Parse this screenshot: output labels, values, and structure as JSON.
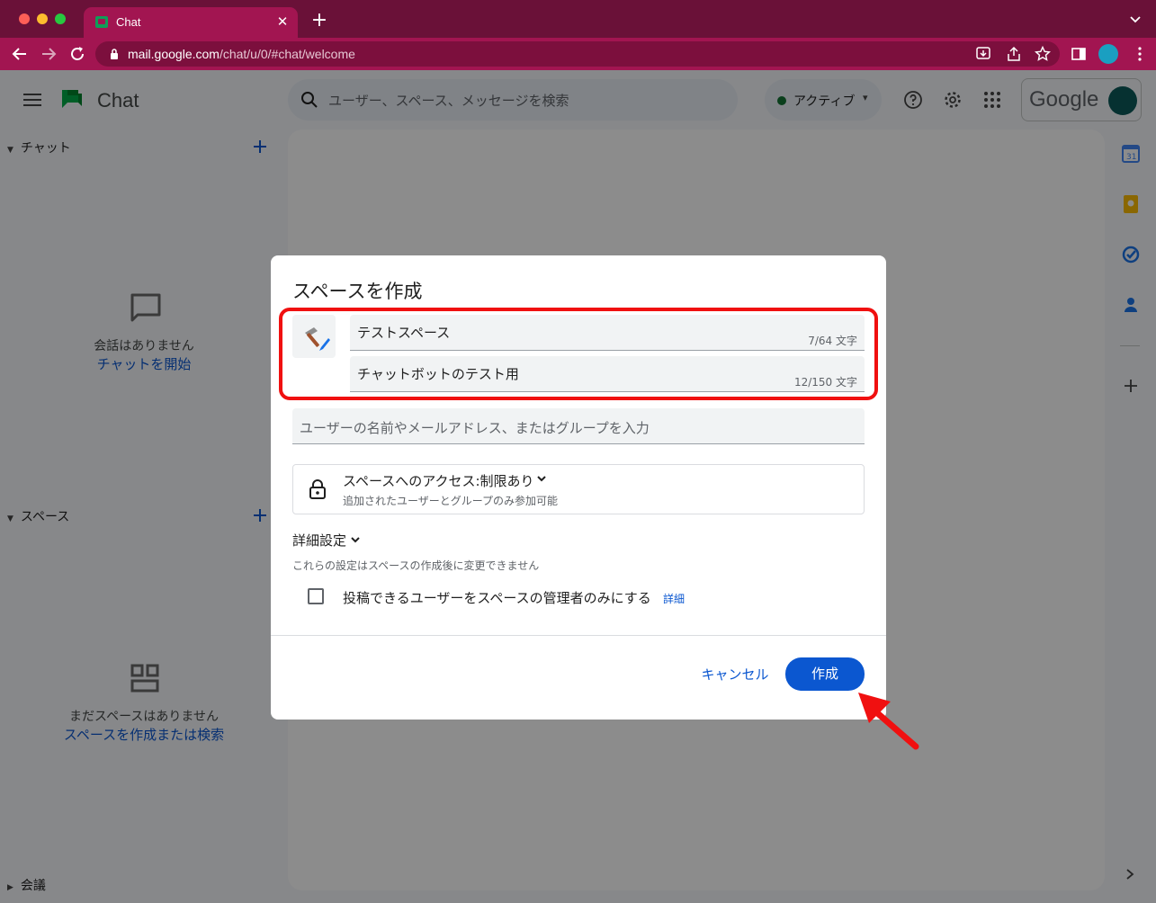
{
  "browser": {
    "tab_title": "Chat",
    "tab_close": "✕",
    "new_tab": "+",
    "url_host": "mail.google.com",
    "url_path": "/chat/u/0/#chat/welcome"
  },
  "header": {
    "app_name": "Chat",
    "search_placeholder": "ユーザー、スペース、メッセージを検索",
    "status_label": "アクティブ",
    "google_wordmark": "Google"
  },
  "sidebar": {
    "chat_section": {
      "label": "チャット",
      "empty_text": "会話はありません",
      "empty_link": "チャットを開始"
    },
    "spaces_section": {
      "label": "スペース",
      "empty_text": "まだスペースはありません",
      "empty_link": "スペースを作成または検索"
    },
    "meet_section": {
      "label": "会議"
    }
  },
  "dialog": {
    "title": "スペースを作成",
    "name_value": "テストスペース",
    "name_count": "7/64 文字",
    "desc_value": "チャットボットのテスト用",
    "desc_count": "12/150 文字",
    "member_placeholder": "ユーザーの名前やメールアドレス、またはグループを入力",
    "access_title": "スペースへのアクセス:制限あり",
    "access_subtitle": "追加されたユーザーとグループのみ参加可能",
    "advanced_label": "詳細設定",
    "advanced_note": "これらの設定はスペースの作成後に変更できません",
    "checkbox_label": "投稿できるユーザーをスペースの管理者のみにする",
    "checkbox_checked": false,
    "details_link": "詳細",
    "cancel_label": "キャンセル",
    "create_label": "作成"
  },
  "colors": {
    "titlebar": "#6a1138",
    "toolbar": "#a21551",
    "accent_blue": "#0b57d0",
    "annotation_red": "#f01010"
  },
  "icons": [
    "hamburger-icon",
    "chat-logo-icon",
    "search-icon",
    "help-icon",
    "settings-icon",
    "apps-grid-icon",
    "calendar-icon",
    "keep-icon",
    "tasks-icon",
    "contacts-icon",
    "lock-icon",
    "chevron-down-icon",
    "add-icon",
    "emoji-icon"
  ]
}
